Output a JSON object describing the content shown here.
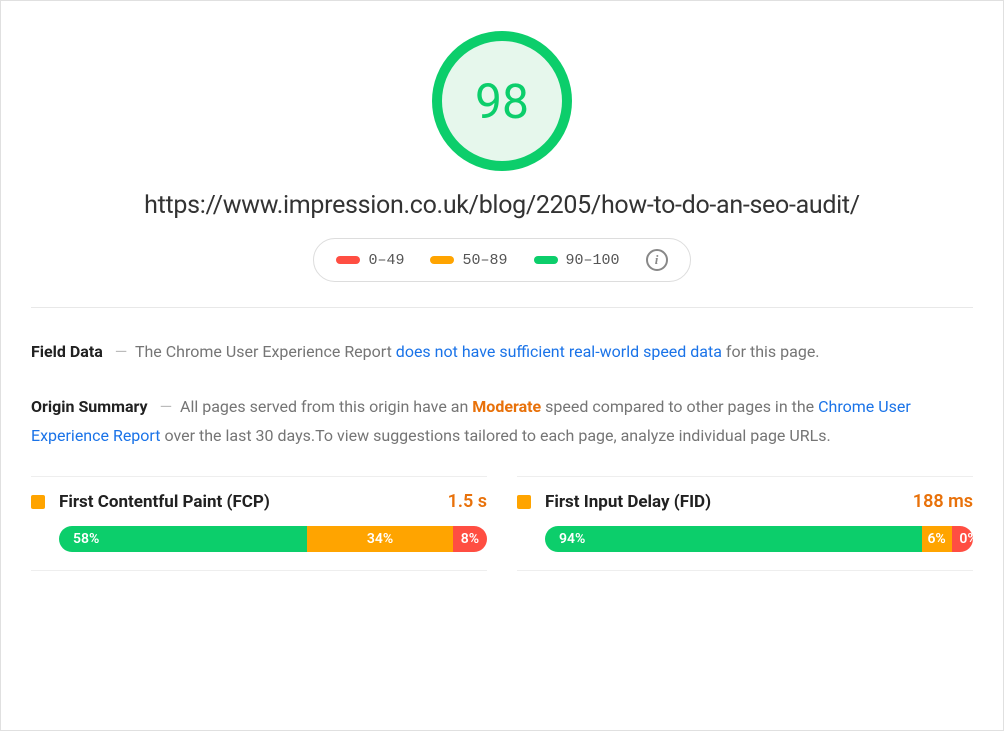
{
  "score": "98",
  "url": "https://www.impression.co.uk/blog/2205/how-to-do-an-seo-audit/",
  "legend": {
    "poor": "0–49",
    "average": "50–89",
    "good": "90–100"
  },
  "fieldData": {
    "label": "Field Data",
    "dash": "—",
    "prefix": "The Chrome User Experience Report ",
    "link": "does not have sufficient real-world speed data",
    "suffix": " for this page."
  },
  "originSummary": {
    "label": "Origin Summary",
    "dash": "—",
    "prefix": "All pages served from this origin have an ",
    "level": "Moderate",
    "mid": " speed compared to other pages in the ",
    "link": "Chrome User Experience Report",
    "suffix": " over the last 30 days.To view suggestions tailored to each page, analyze individual page URLs."
  },
  "metrics": {
    "fcp": {
      "name": "First Contentful Paint (FCP)",
      "value": "1.5 s",
      "dist": {
        "green": "58%",
        "orange": "34%",
        "red": "8%"
      },
      "widths": {
        "green": 58,
        "orange": 34,
        "red": 8
      }
    },
    "fid": {
      "name": "First Input Delay (FID)",
      "value": "188 ms",
      "dist": {
        "green": "94%",
        "orange": "6%",
        "red": "0%"
      },
      "widths": {
        "green": 88,
        "orange": 7,
        "red": 5
      }
    }
  }
}
